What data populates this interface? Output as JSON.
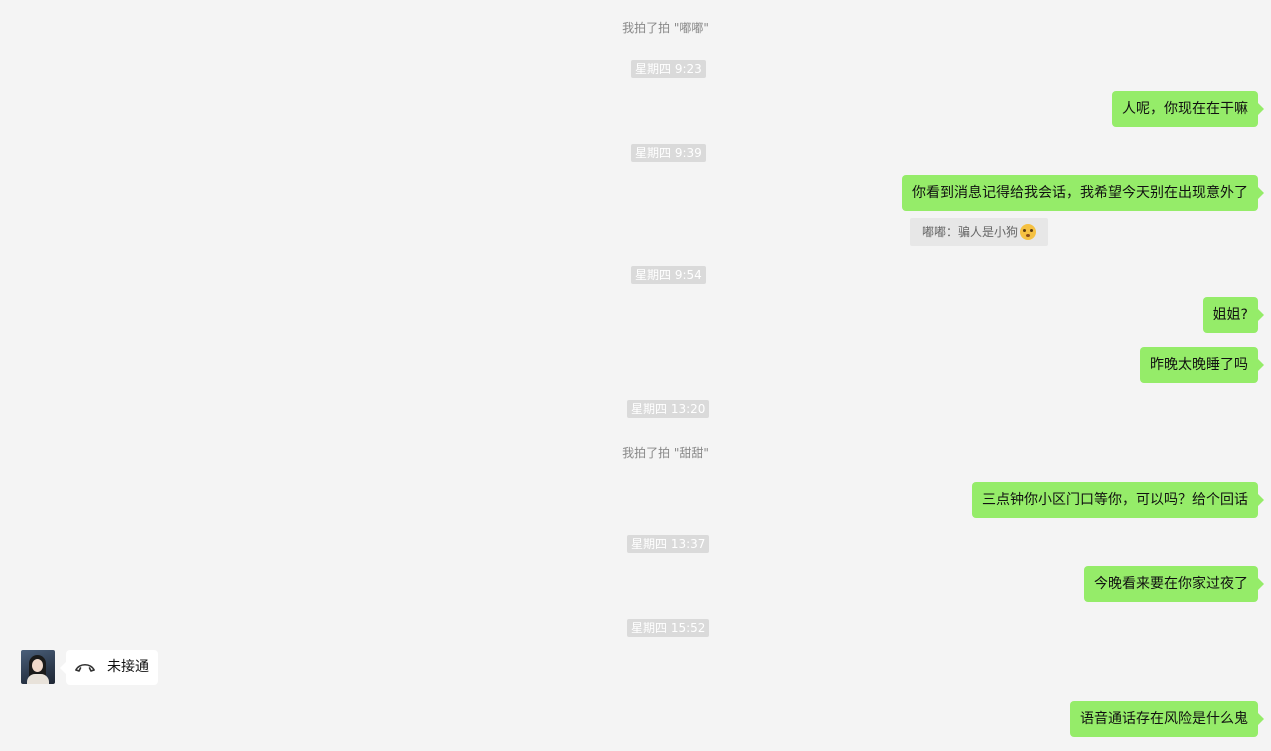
{
  "messages": {
    "sys_pat_1": "我拍了拍 \"嘟嘟\"",
    "ts_1": "星期四 9:23",
    "msg_1": "人呢，你现在在干嘛",
    "ts_2": "星期四 9:39",
    "msg_2": "你看到消息记得给我会话，我希望今天别在出现意外了",
    "quote_1": "嘟嘟：骗人是小狗",
    "ts_3": "星期四 9:54",
    "msg_3": "姐姐?",
    "msg_4": "昨晚太晚睡了吗",
    "ts_4": "星期四 13:20",
    "sys_pat_2": "我拍了拍 \"甜甜\"",
    "msg_5": "三点钟你小区门口等你，可以吗？给个回话",
    "ts_5": "星期四 13:37",
    "msg_6": "今晚看来要在你家过夜了",
    "ts_6": "星期四 15:52",
    "call_status": "未接通",
    "msg_7": "语音通话存在风险是什么鬼"
  },
  "icons": {
    "quote_emoji": "flushed-face-icon",
    "call_icon": "phone-hangup-icon",
    "contact_avatar": "avatar"
  },
  "colors": {
    "background": "#f4f4f4",
    "sent_bubble": "#95ec69",
    "received_bubble": "#ffffff",
    "timestamp_bg": "#dadada"
  }
}
